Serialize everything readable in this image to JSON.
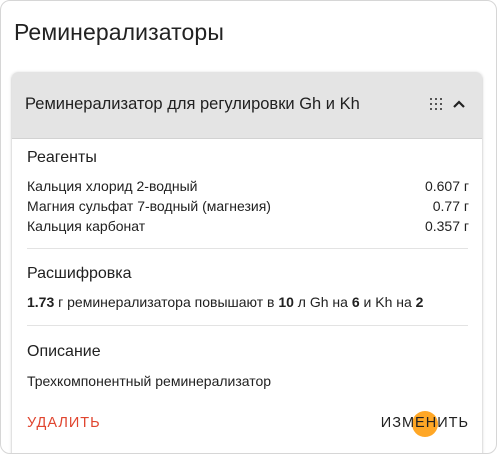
{
  "page": {
    "title": "Реминерализаторы"
  },
  "card": {
    "title": "Реминерализатор для регулировки Gh и Kh",
    "icons": [
      "grid-dots-icon",
      "chevron-up-icon"
    ],
    "reagents": {
      "heading": "Реагенты",
      "items": [
        {
          "name": "Кальция хлорид 2-водный",
          "amount": "0.607 г"
        },
        {
          "name": "Магния сульфат 7-водный (магнезия)",
          "amount": "0.77 г"
        },
        {
          "name": "Кальция карбонат",
          "amount": "0.357 г"
        }
      ]
    },
    "decoding": {
      "heading": "Расшифровка",
      "mass": "1.73",
      "text1": " г реминерализатора повышают в ",
      "volume": "10",
      "text2": " л Gh на ",
      "gh": "6",
      "text3": " и Kh на ",
      "kh": "2"
    },
    "description": {
      "heading": "Описание",
      "text": "Трехкомпонентный реминерализатор"
    },
    "actions": {
      "delete_label": "УДАЛИТЬ",
      "edit_label": "ИЗМЕНИТЬ"
    }
  },
  "colors": {
    "header_bg": "#e4e4e4",
    "delete_accent": "#e0452f",
    "ripple": "#ff9800"
  }
}
